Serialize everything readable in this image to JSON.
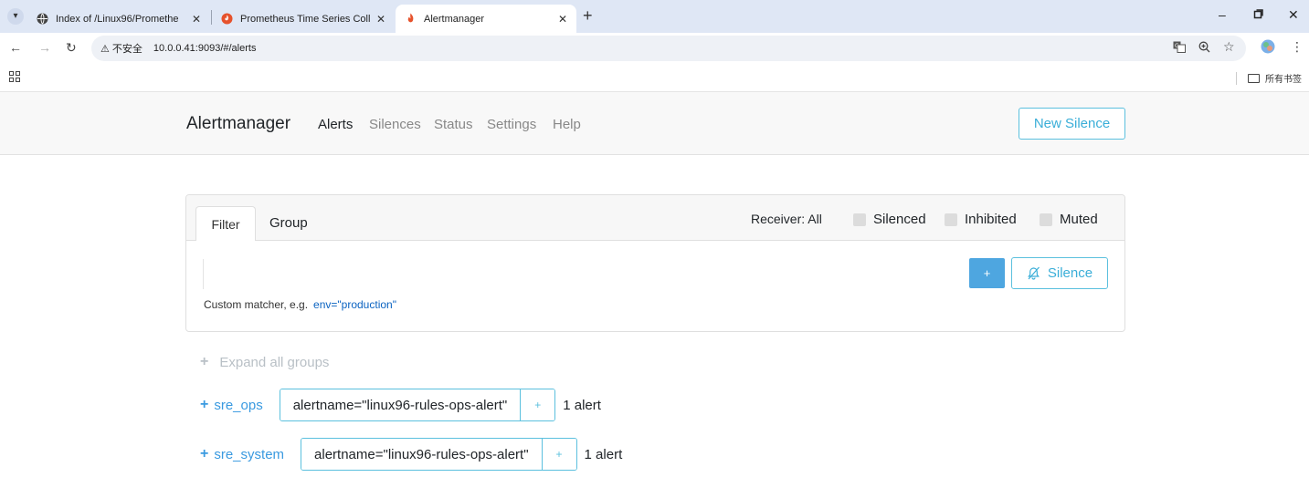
{
  "browser": {
    "tabs": [
      {
        "title": "Index of /Linux96/Promethe",
        "active": false
      },
      {
        "title": "Prometheus Time Series Coll",
        "active": false
      },
      {
        "title": "Alertmanager",
        "active": true
      }
    ],
    "tab_close_glyph": "✕",
    "new_tab_glyph": "+",
    "insecure_label": "⚠ 不安全",
    "url": "10.0.0.41:9093/#/alerts",
    "bookmarks_all_label": "所有书签"
  },
  "navbar": {
    "brand": "Alertmanager",
    "links": [
      "Alerts",
      "Silences",
      "Status",
      "Settings",
      "Help"
    ],
    "active_link": "Alerts",
    "new_silence_label": "New Silence"
  },
  "filter_card": {
    "tabs": {
      "filter": "Filter",
      "group": "Group"
    },
    "receiver_label": "Receiver: All",
    "checkboxes": [
      "Silenced",
      "Inhibited",
      "Muted"
    ],
    "input_value": "",
    "add_label": "+",
    "silence_label": "Silence",
    "hint_text": "Custom matcher, e.g.",
    "hint_example": "env=\"production\""
  },
  "groups": {
    "expand_all_label": "Expand all groups",
    "items": [
      {
        "receiver": "sre_ops",
        "label": "alertname=\"linux96-rules-ops-alert\"",
        "count_label": "1 alert"
      },
      {
        "receiver": "sre_system",
        "label": "alertname=\"linux96-rules-ops-alert\"",
        "count_label": "1 alert"
      }
    ]
  },
  "colors": {
    "accent": "#5bc0de",
    "link": "#3a9ae0",
    "primary_button": "#4ea6e0"
  }
}
